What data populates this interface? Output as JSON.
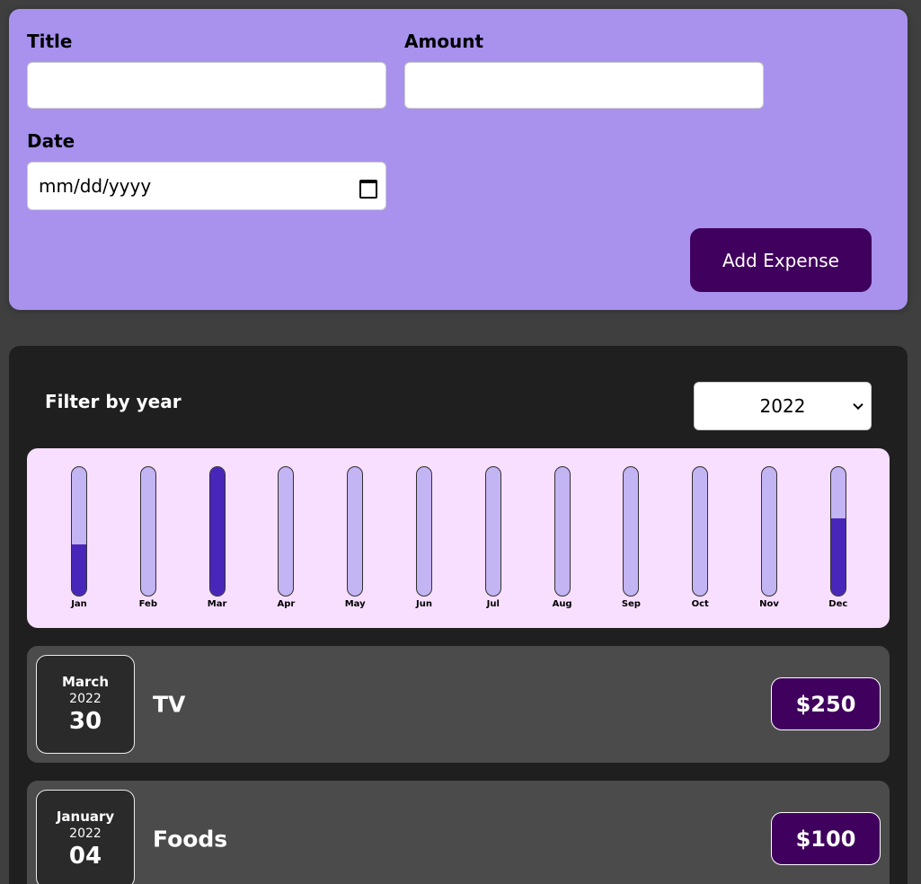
{
  "form": {
    "title_label": "Title",
    "title_value": "",
    "amount_label": "Amount",
    "amount_value": "",
    "date_label": "Date",
    "date_placeholder": "mm/dd/yyyy",
    "submit_label": "Add Expense"
  },
  "filter": {
    "label": "Filter by year",
    "selected_year": "2022"
  },
  "chart_data": {
    "type": "bar",
    "categories": [
      "Jan",
      "Feb",
      "Mar",
      "Apr",
      "May",
      "Jun",
      "Jul",
      "Aug",
      "Sep",
      "Oct",
      "Nov",
      "Dec"
    ],
    "values": [
      100,
      0,
      250,
      0,
      0,
      0,
      0,
      0,
      0,
      0,
      0,
      150
    ],
    "ylim": [
      0,
      250
    ],
    "colors": {
      "track": "#c3b4f3",
      "fill": "#4826b9",
      "background": "#f8dfff"
    }
  },
  "expenses": [
    {
      "month": "March",
      "year": "2022",
      "day": "30",
      "title": "TV",
      "amount": "$250"
    },
    {
      "month": "January",
      "year": "2022",
      "day": "04",
      "title": "Foods",
      "amount": "$100"
    }
  ],
  "colors": {
    "form_bg": "#a892ee",
    "button_bg": "#40005d",
    "list_bg": "#1f1f1f",
    "item_bg": "#4b4b4b"
  }
}
